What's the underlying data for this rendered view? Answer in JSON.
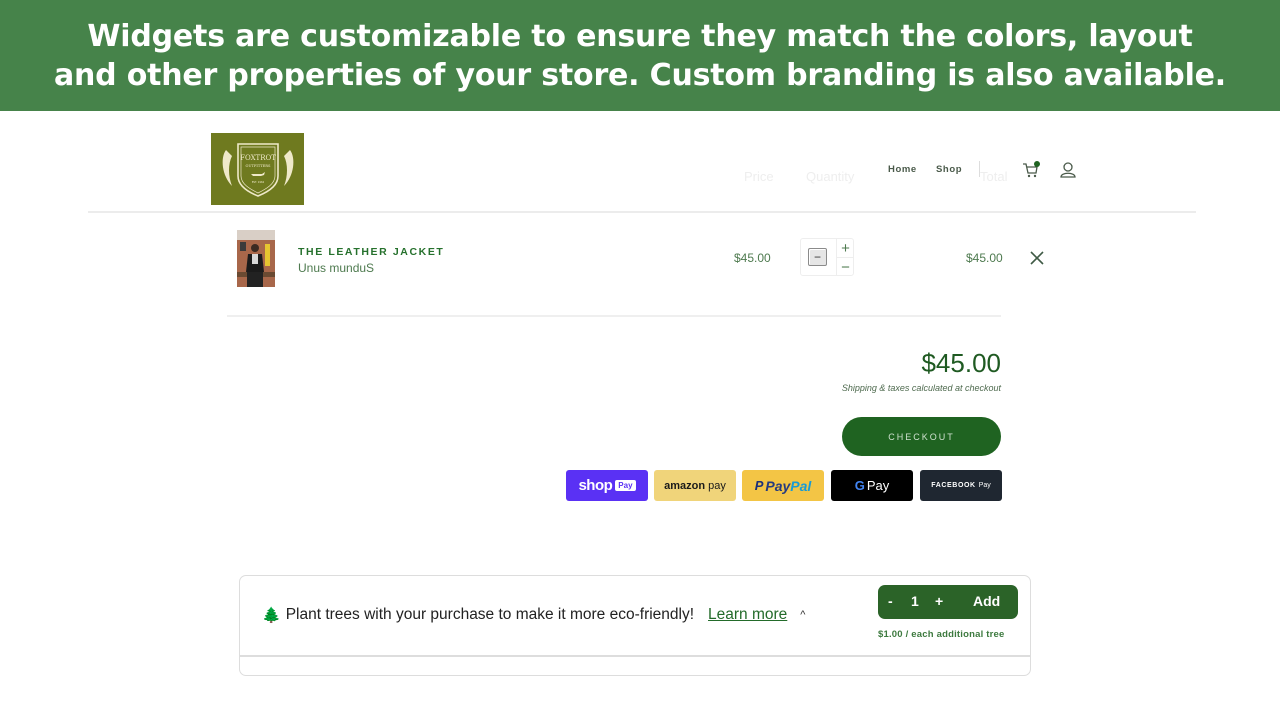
{
  "banner": {
    "line1": "Widgets are customizable to ensure they match the colors, layout",
    "line2": "and other properties of your store. Custom branding is also available."
  },
  "header": {
    "logo": {
      "name": "FOXTROT",
      "sub": "OUTFITTERS",
      "est": "EST. 1962"
    },
    "nav": [
      {
        "label": "Home"
      },
      {
        "label": "Shop"
      }
    ],
    "ghost_columns": [
      "Price",
      "Quantity",
      "Total"
    ],
    "cart_icon": "cart-icon",
    "cart_badge_color": "#1f6321",
    "account_icon": "account-icon"
  },
  "cart": {
    "items": [
      {
        "title": "THE LEATHER JACKET",
        "variant": "Unus munduS",
        "price": "$45.00",
        "quantity_input": "−",
        "increment": "+",
        "decrement": "−",
        "line_total": "$45.00"
      }
    ],
    "subtotal": "$45.00",
    "shipping_note": "Shipping & taxes calculated at checkout",
    "checkout_label": "CHECKOUT"
  },
  "payments": [
    {
      "name": "Shop Pay",
      "text_main": "shop",
      "text_badge": "Pay"
    },
    {
      "name": "Amazon Pay",
      "text_main": "amazon",
      "text_sub": "pay"
    },
    {
      "name": "PayPal",
      "text_pay": "Pay",
      "text_pal": "Pal"
    },
    {
      "name": "Google Pay",
      "text_g": "G",
      "text_main": "Pay"
    },
    {
      "name": "Facebook Pay",
      "text_main": "FACEBOOK",
      "text_sub": "Pay"
    }
  ],
  "tree_widget": {
    "icon": "🌲",
    "message": "Plant trees with your purchase to make it more eco-friendly!",
    "learn_more": "Learn more",
    "chevron": "^",
    "minus": "-",
    "count": "1",
    "plus": "+",
    "add_label": "Add",
    "price_note": "$1.00 / each additional tree"
  },
  "colors": {
    "banner_bg": "#46834a",
    "brand_green": "#1f6321",
    "logo_bg": "#6f7a1f"
  }
}
